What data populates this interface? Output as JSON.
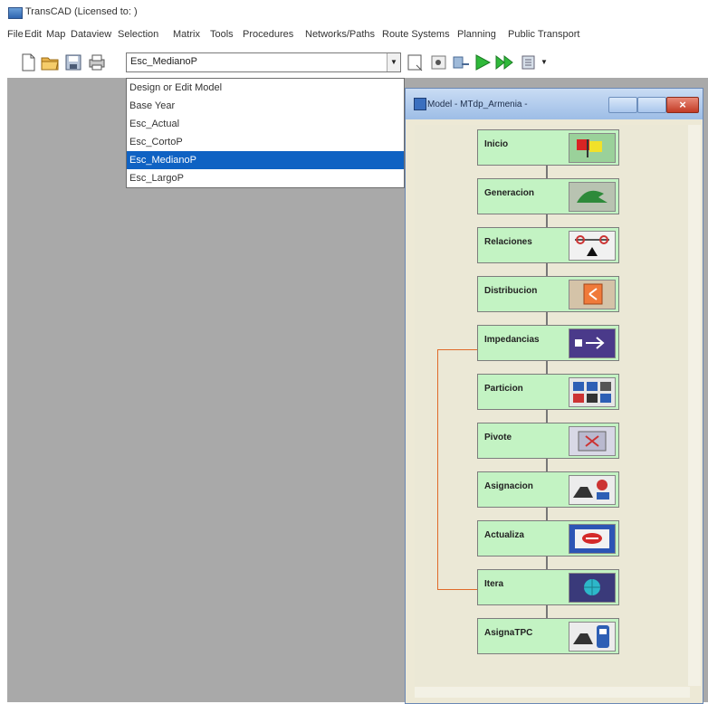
{
  "app": {
    "title": "TransCAD (Licensed to:              )"
  },
  "menu": [
    "File",
    "Edit",
    "Map",
    "Dataview",
    "Selection",
    "Matrix",
    "Tools",
    "Procedures",
    "Networks/Paths",
    "Route Systems",
    "Planning",
    "Public Transport"
  ],
  "toolbar": {
    "scenario_value": "Esc_MedianoP"
  },
  "dropdown": {
    "options": [
      "Design or Edit Model",
      "Base Year",
      "Esc_Actual",
      "Esc_CortoP",
      "Esc_MedianoP",
      "Esc_LargoP"
    ],
    "selected": "Esc_MedianoP"
  },
  "model_window": {
    "title": "Model - MTdp_Armenia -",
    "steps": [
      "Inicio",
      "Generacion",
      "Relaciones",
      "Distribucion",
      "Impedancias",
      "Particion",
      "Pivote",
      "Asignacion",
      "Actualiza",
      "Itera",
      "AsignaTPC"
    ]
  },
  "colors": {
    "step_fill": "#c3f3c3",
    "selection": "#0f62c3",
    "loop_line": "#e06a2a",
    "workspace": "#a9a9a9"
  }
}
